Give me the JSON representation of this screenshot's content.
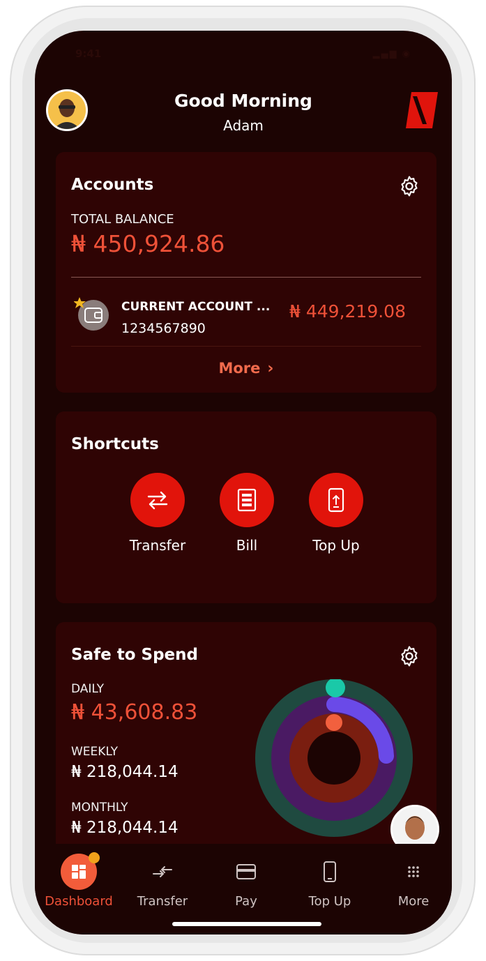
{
  "status_bar": {
    "time": "9:41",
    "icons": "▂▄▆ ◉"
  },
  "header": {
    "greeting": "Good Morning",
    "name": "Adam"
  },
  "accounts": {
    "title": "Accounts",
    "total_label": "TOTAL BALANCE",
    "total_value": "₦ 450,924.86",
    "account_name": "CURRENT ACCOUNT ...",
    "account_number": "1234567890",
    "account_balance": "₦ 449,219.08",
    "more_label": "More"
  },
  "shortcuts": {
    "title": "Shortcuts",
    "items": [
      {
        "label": "Transfer",
        "icon": "transfer-arrows-icon"
      },
      {
        "label": "Bill",
        "icon": "bill-icon"
      },
      {
        "label": "Top Up",
        "icon": "phone-topup-icon"
      }
    ]
  },
  "safe_to_spend": {
    "title": "Safe to Spend",
    "daily_label": "DAILY",
    "daily_value": "₦ 43,608.83",
    "weekly_label": "WEEKLY",
    "weekly_value": "₦ 218,044.14",
    "monthly_label": "MONTHLY",
    "monthly_value": "₦ 218,044.14"
  },
  "nav": {
    "items": [
      {
        "label": "Dashboard",
        "icon": "dashboard-icon",
        "active": true
      },
      {
        "label": "Transfer",
        "icon": "transfer-icon"
      },
      {
        "label": "Pay",
        "icon": "card-icon"
      },
      {
        "label": "Top Up",
        "icon": "phone-icon"
      },
      {
        "label": "More",
        "icon": "grid-dots-icon"
      }
    ]
  },
  "colors": {
    "background": "#1c0403",
    "card": "#2f0404",
    "accent": "#ee5138",
    "button_red": "#e1140b",
    "ring_teal": "#1f4a40",
    "ring_purple": "#4a1a63",
    "ring_red": "#7a1e10",
    "progress_purple": "#6a4ae8",
    "progress_teal": "#1ac9a8",
    "progress_orange": "#f2603e"
  }
}
